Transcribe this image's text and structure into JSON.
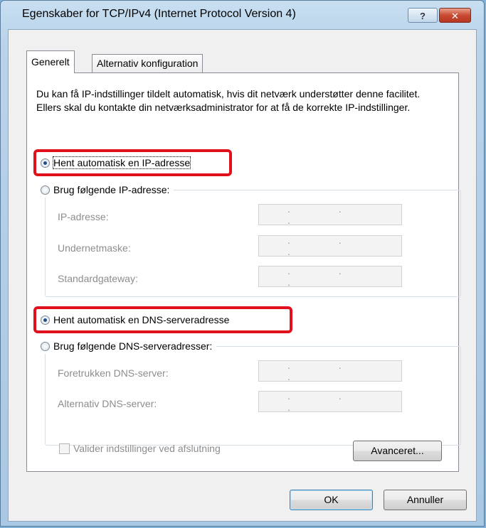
{
  "window": {
    "title": "Egenskaber for TCP/IPv4 (Internet Protocol Version 4)",
    "help_label": "?",
    "close_label": "✕"
  },
  "tabs": [
    {
      "label": "Generelt",
      "active": true
    },
    {
      "label": "Alternativ konfiguration",
      "active": false
    }
  ],
  "intro_text": "Du kan få IP-indstillinger tildelt automatisk, hvis dit netværk understøtter denne facilitet. Ellers skal du kontakte din netværksadministrator for at få de korrekte IP-indstillinger.",
  "ip": {
    "auto_label": "Hent automatisk en IP-adresse",
    "manual_label": "Brug følgende IP-adresse:",
    "selected": "auto",
    "fields": [
      {
        "label": "IP-adresse:",
        "value": ". . ."
      },
      {
        "label": "Undernetmaske:",
        "value": ". . ."
      },
      {
        "label": "Standardgateway:",
        "value": ". . ."
      }
    ]
  },
  "dns": {
    "auto_label": "Hent automatisk en DNS-serveradresse",
    "manual_label": "Brug følgende DNS-serveradresser:",
    "selected": "auto",
    "fields": [
      {
        "label": "Foretrukken DNS-server:",
        "value": ". . ."
      },
      {
        "label": "Alternativ DNS-server:",
        "value": ". . ."
      }
    ]
  },
  "validate_label": "Valider indstillinger ved afslutning",
  "validate_checked": false,
  "advanced_label": "Avanceret...",
  "ok_label": "OK",
  "cancel_label": "Annuller",
  "colors": {
    "highlight": "#e0111c",
    "selected_radio": "#1e4f92"
  }
}
